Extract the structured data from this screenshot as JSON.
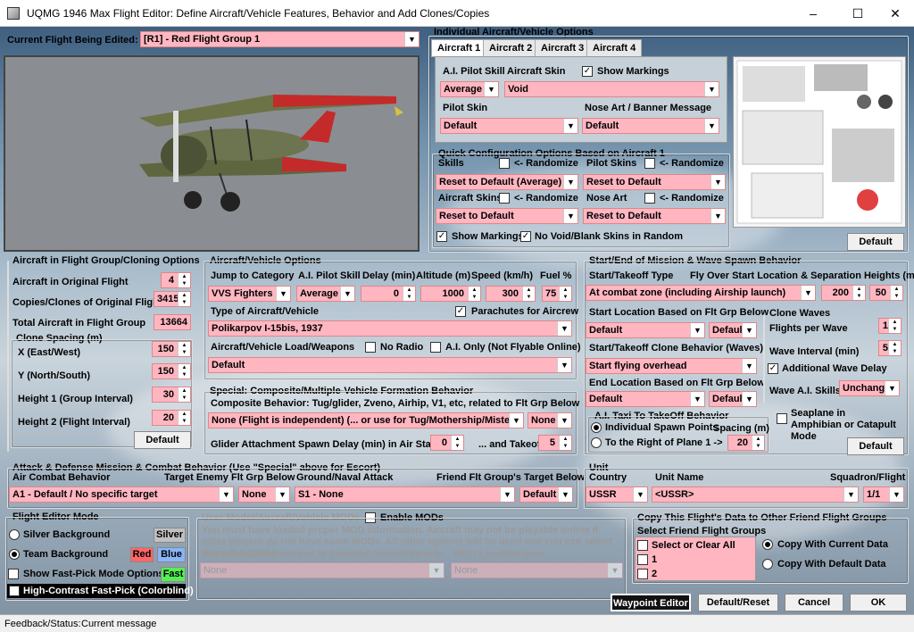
{
  "window": {
    "title": "UQMG 1946 Max Flight Editor:  Define Aircraft/Vehicle Features, Behavior and Add Clones/Copies",
    "min": "–",
    "max": "☐",
    "close": "✕"
  },
  "flight": {
    "label": "Current Flight Being Edited:",
    "value": "[R1] -  Red Flight Group  1"
  },
  "individual": {
    "title": "Individual Aircraft/Vehicle Options",
    "tabs": [
      "Aircraft 1",
      "Aircraft 2",
      "Aircraft 3",
      "Aircraft 4"
    ],
    "pilot_skill_label": "A.I. Pilot Skill",
    "pilot_skill": "Average",
    "skin_label": "Aircraft Skin",
    "skin": "Void",
    "show_markings": "Show Markings",
    "pilot_skin_label": "Pilot Skin",
    "pilot_skin": "Default",
    "nose_art_label": "Nose Art / Banner Message",
    "nose_art": "Default",
    "default_btn": "Default"
  },
  "quick": {
    "title": "Quick Configuration Options Based on Aircraft 1",
    "skills": "Skills",
    "randomize": "<- Randomize",
    "pilot_skins": "Pilot Skins",
    "skills_val": "Reset to Default (Average)",
    "pilot_skins_val": "Reset to Default",
    "aircraft_skins": "Aircraft Skins",
    "nose_art": "Nose Art",
    "aircraft_skins_val": "Reset to Default",
    "nose_art_val": "Reset to Default",
    "show_markings": "Show Markings",
    "no_void": "No Void/Blank Skins in Random"
  },
  "group": {
    "title": "Aircraft in Flight Group/Cloning Options",
    "orig_label": "Aircraft in Original Flight",
    "orig": "4",
    "copies_label": "Copies/Clones of Original Flight",
    "copies": "3415",
    "total_label": "Total Aircraft in Flight Group",
    "total": "13664",
    "spacing_title": "Clone Spacing (m)",
    "x_label": "X (East/West)",
    "x": "150",
    "y_label": "Y (North/South)",
    "y": "150",
    "h1_label": "Height 1 (Group Interval)",
    "h1": "30",
    "h2_label": "Height 2 (Flight Interval)",
    "h2": "20",
    "default_btn": "Default"
  },
  "vehicle": {
    "title": "Aircraft/Vehicle Options",
    "jump_label": "Jump to Category",
    "jump": "VVS Fighters",
    "skill_label": "A.I. Pilot Skill",
    "skill": "Average",
    "delay_label": "Delay (min)",
    "delay": "0",
    "alt_label": "Altitude (m)",
    "alt": "1000",
    "speed_label": "Speed (km/h)",
    "speed": "300",
    "fuel_label": "Fuel %",
    "fuel": "75",
    "type_label": "Type of Aircraft/Vehicle",
    "parachutes": "Parachutes for Aircrew",
    "type": "Polikarpov I-15bis, 1937",
    "load_label": "Aircraft/Vehicle Load/Weapons",
    "no_radio": "No Radio",
    "ai_only": "A.I. Only (Not Flyable Online)",
    "load": "Default"
  },
  "special": {
    "title": "Special: Composite/Multiple-Vehicle Formation Behavior",
    "behavior_label": "Composite Behavior: Tug/glider, Zveno, Airhip, V1, etc, related to Flt Grp Below",
    "behavior": "None (Flight is independent) (... or use for Tug/Mothership/Mistel Bo",
    "none": "None",
    "glider_label": "Glider Attachment Spawn Delay (min) in Air Start",
    "glider": "0",
    "takeoff_label": "... and Takeoff",
    "takeoff": "5"
  },
  "start": {
    "title": "Start/End of Mission & Wave Spawn Behavior",
    "type_label": "Start/Takeoff Type",
    "flyover_label": "Fly Over Start Location & Separation Heights (m)",
    "type": "At combat zone (including Airship launch)",
    "h1": "200",
    "h2": "50",
    "loc_label": "Start Location Based on Flt Grp Below",
    "loc": "Default",
    "loc2": "Defaul",
    "clone_label": "Start/Takeoff Clone Behavior (Waves)",
    "clone": "Start flying overhead",
    "end_label": "End Location Based on Flt Grp Below",
    "end": "Default",
    "end2": "Defaul",
    "waves_title": "Clone Waves",
    "fpw_label": "Flights per Wave",
    "fpw": "1",
    "interval_label": "Wave Interval (min)",
    "interval": "5",
    "add_delay": "Additional Wave Delay",
    "wave_skill_label": "Wave A.I. Skills",
    "wave_skill": "Unchange",
    "taxi_title": "A.I. Taxi To TakeOff Behavior",
    "taxi1": "Individual Spawn Points",
    "spacing_label": "Spacing (m)",
    "taxi2": "To the Right of Plane 1 ->",
    "spacing": "20",
    "seaplane": "Seaplane in Amphibian or Catapult Mode",
    "default_btn": "Default"
  },
  "attack": {
    "title": "Attack & Defense Mission & Combat Behavior (Use \"Special\" above for Escort)",
    "air_label": "Air Combat Behavior",
    "target_label": "Target Enemy Flt Grp Below",
    "ground_label": "Ground/Naval Attack",
    "friend_label": "Friend Flt Group's Target Below",
    "air": "A1 - Default / No specific target",
    "target": "None",
    "ground": "S1 - None",
    "friend": "Default"
  },
  "unit": {
    "title": "Unit",
    "country_label": "Country",
    "name_label": "Unit Name",
    "squadron_label": "Squadron/Flight",
    "country": "USSR",
    "name": "<USSR>",
    "squadron": "1/1"
  },
  "mode": {
    "title": "Flight Editor Mode",
    "silver": "Silver Background",
    "silver_btn": "Silver",
    "team": "Team Background",
    "red": "Red",
    "blue": "Blue",
    "fast": "Show Fast-Pick Mode Options",
    "fast_btn": "Fast",
    "contrast": "High-Contrast Fast-Pick (Colorblind)"
  },
  "mods": {
    "title": "User Model/Aircraft/Vehicle MODs",
    "enable": "Enable MODs",
    "note": "You must have loaded proper MOD information. Aircraft may not be playable online if other players do not have same MODs. All other options will be used and you can select skins if available.",
    "use_label": "Use MOD Below Instead of Selected Aircraft/Vehicle",
    "load_label": "MOD Load/Weapon",
    "use": "None",
    "load": "None"
  },
  "copy": {
    "title": "Copy This Flight's Data to Other Friend Flight Groups",
    "select_label": "Select Friend Flight Groups",
    "items": [
      "Select or Clear All",
      "1",
      "2"
    ],
    "current": "Copy With Current Data",
    "default": "Copy With Default Data"
  },
  "buttons": {
    "waypoint": "Waypoint Editor",
    "reset": "Default/Reset",
    "cancel": "Cancel",
    "ok": "OK"
  },
  "status": {
    "label": "Feedback/Status:",
    "value": "Current message"
  }
}
